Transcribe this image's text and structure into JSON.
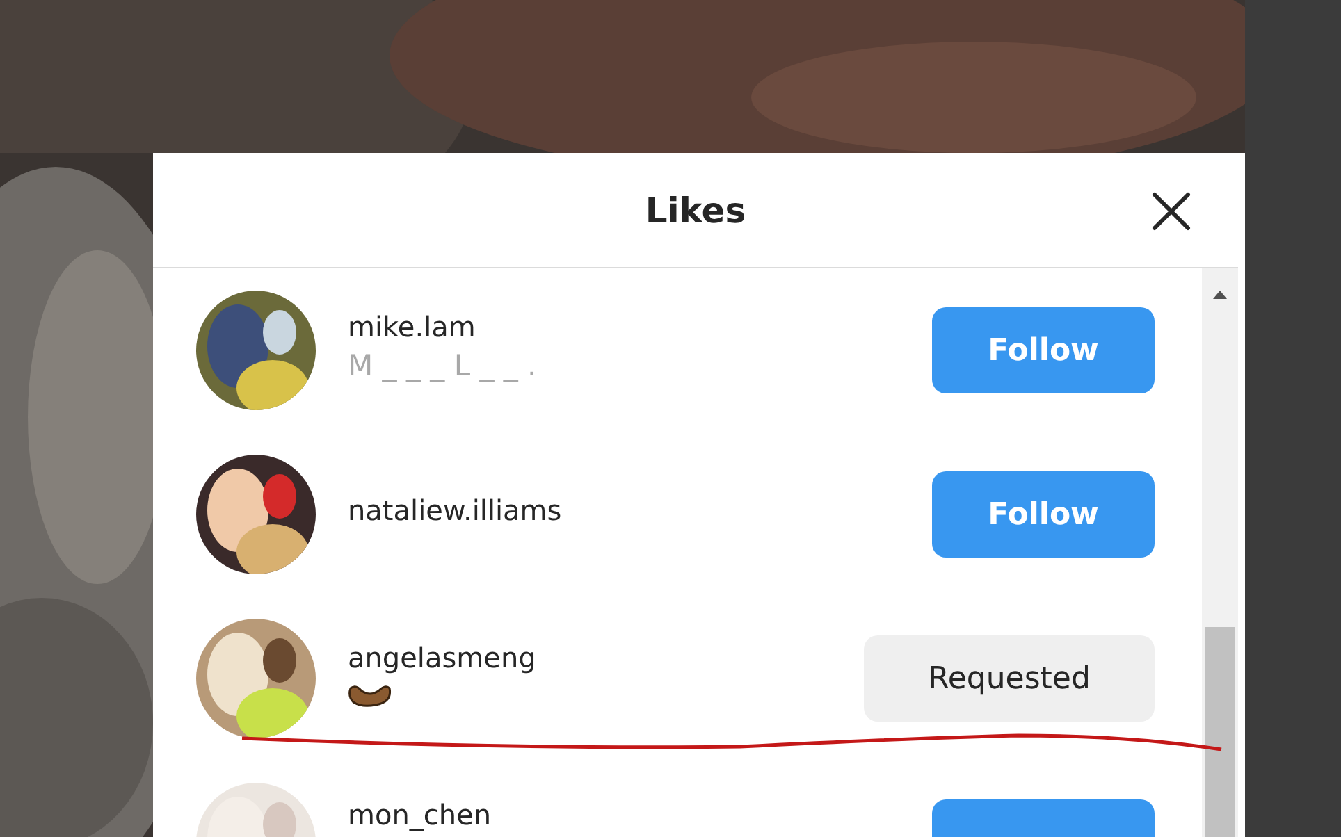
{
  "dialog": {
    "title": "Likes"
  },
  "users": [
    {
      "name": "mike.lam",
      "subtitle": "M _ _ _ L _ _ .",
      "button": {
        "kind": "follow",
        "label": "Follow"
      }
    },
    {
      "name": "nataliew.illiams",
      "button": {
        "kind": "follow",
        "label": "Follow"
      }
    },
    {
      "name": "angelasmeng",
      "subtitle_emoji": true,
      "button": {
        "kind": "requested",
        "label": "Requested"
      }
    },
    {
      "name": "mon_chen",
      "button": {
        "kind": "follow"
      }
    }
  ],
  "annotation": {
    "kind": "underline"
  }
}
